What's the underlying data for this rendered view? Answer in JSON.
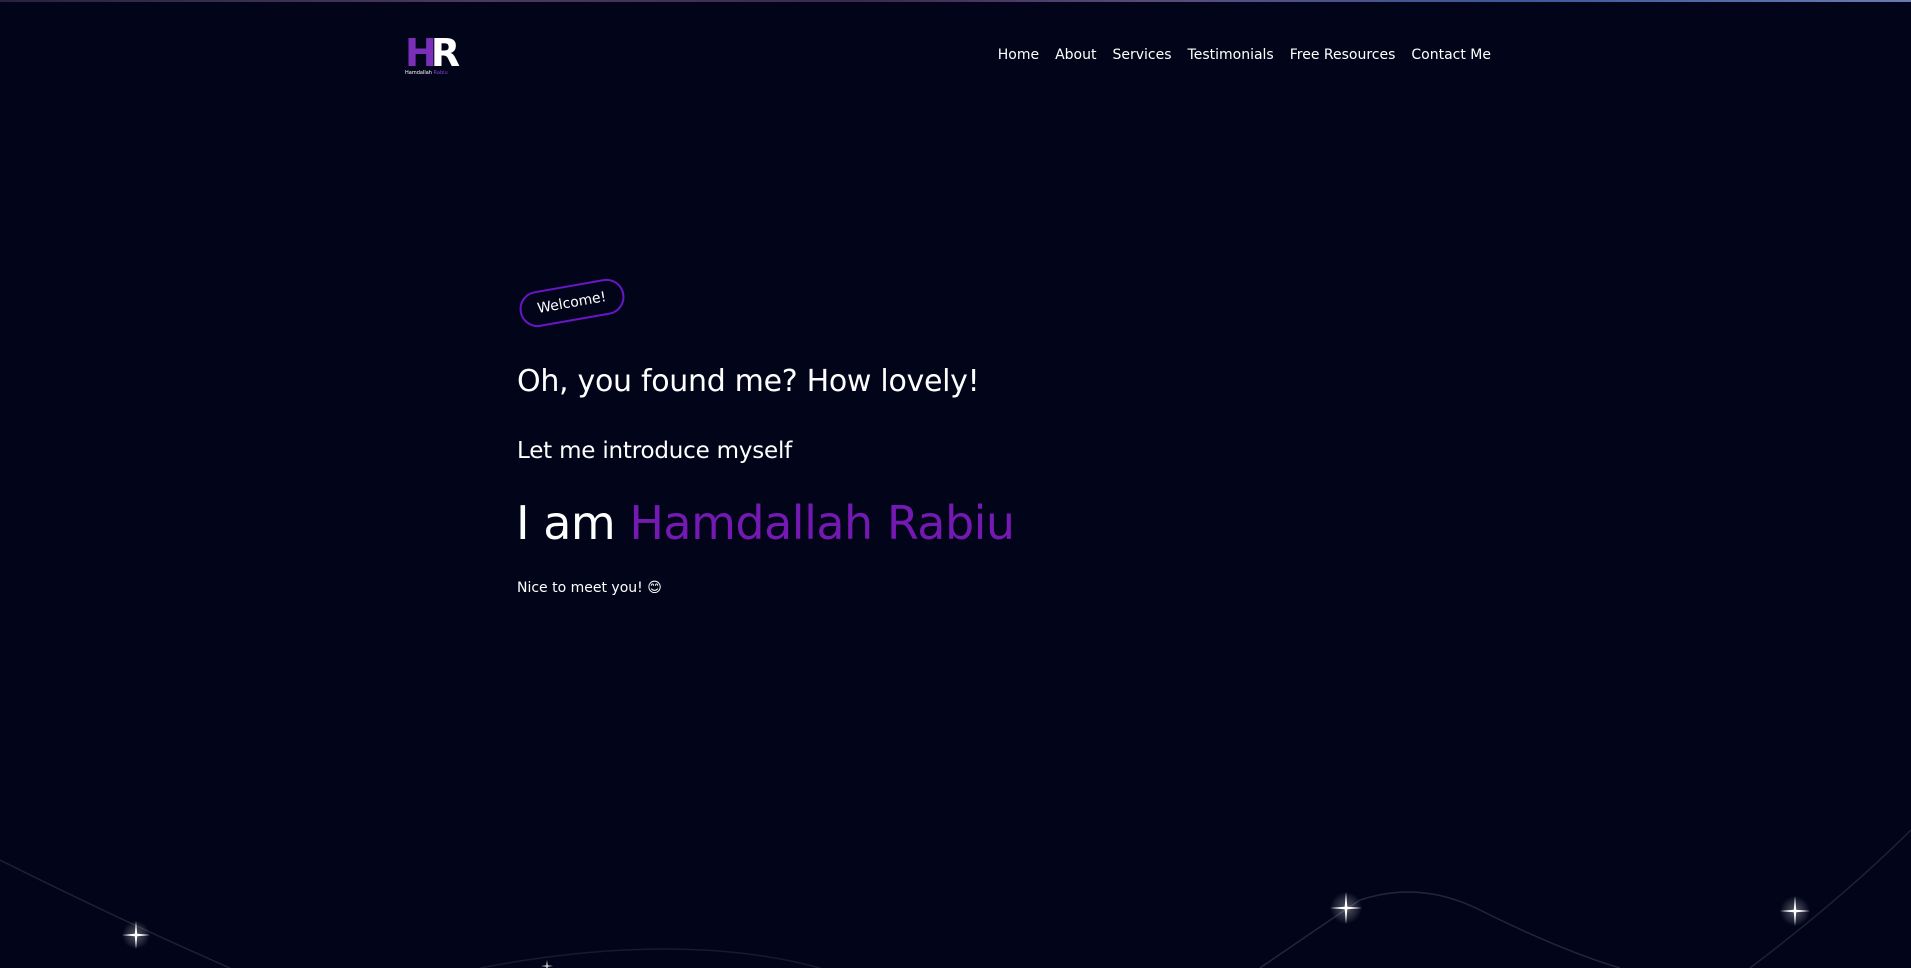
{
  "brand": {
    "logo_mark_h": "H",
    "logo_mark_r": "R",
    "logo_sub_first": "Hamdallah",
    "logo_sub_last": "Rabiu",
    "accent_color": "#7419b2"
  },
  "nav": {
    "items": [
      {
        "label": "Home"
      },
      {
        "label": "About"
      },
      {
        "label": "Services"
      },
      {
        "label": "Testimonials"
      },
      {
        "label": "Free Resources"
      },
      {
        "label": "Contact Me"
      }
    ]
  },
  "hero": {
    "badge": "Welcome!",
    "headline": "Oh, you found me? How lovely!",
    "intro": "Let me introduce myself",
    "name_prefix": "I am ",
    "name": "Hamdallah Rabiu",
    "greeting": "Nice to meet you! 😊"
  },
  "colors": {
    "background": "#02051a",
    "badge_border": "#6a16c8",
    "text": "#ffffff"
  }
}
